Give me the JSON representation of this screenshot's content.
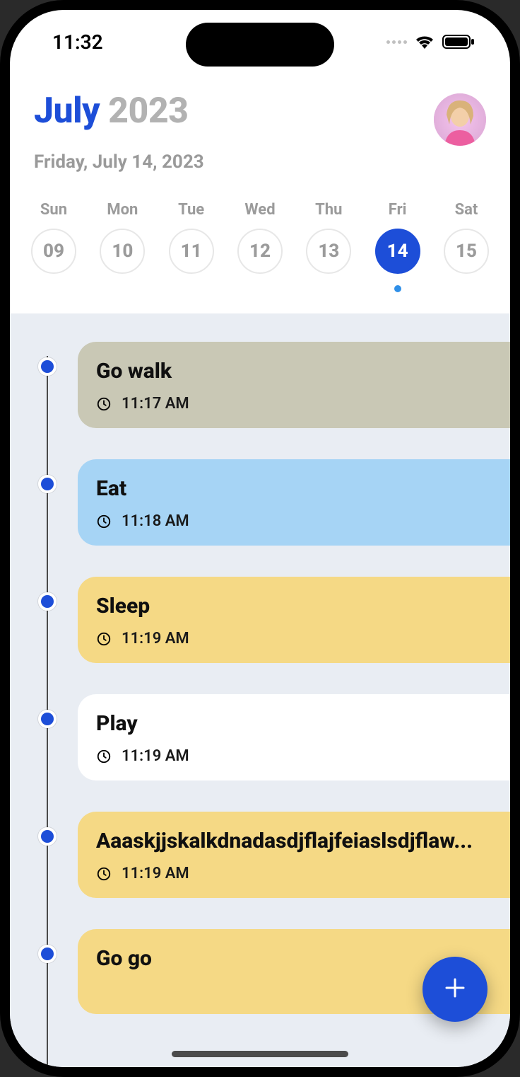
{
  "status": {
    "time": "11:32"
  },
  "header": {
    "month": "July",
    "year": "2023",
    "subtitle": "Friday, July 14, 2023"
  },
  "week": {
    "days": [
      {
        "label": "Sun",
        "num": "09",
        "selected": false,
        "dot": false
      },
      {
        "label": "Mon",
        "num": "10",
        "selected": false,
        "dot": false
      },
      {
        "label": "Tue",
        "num": "11",
        "selected": false,
        "dot": false
      },
      {
        "label": "Wed",
        "num": "12",
        "selected": false,
        "dot": false
      },
      {
        "label": "Thu",
        "num": "13",
        "selected": false,
        "dot": false
      },
      {
        "label": "Fri",
        "num": "14",
        "selected": true,
        "dot": true
      },
      {
        "label": "Sat",
        "num": "15",
        "selected": false,
        "dot": false
      }
    ]
  },
  "timeline": {
    "items": [
      {
        "title": "Go walk",
        "time": "11:17 AM",
        "color": "beige"
      },
      {
        "title": "Eat",
        "time": "11:18 AM",
        "color": "blue"
      },
      {
        "title": "Sleep",
        "time": "11:19 AM",
        "color": "yellow"
      },
      {
        "title": "Play",
        "time": "11:19 AM",
        "color": "white"
      },
      {
        "title": "Aaaskjjskalkdnadasdjflajfeiaslsdjflaw...",
        "time": "11:19 AM",
        "color": "yellow"
      },
      {
        "title": "Go go",
        "time": "",
        "color": "yellow"
      }
    ]
  }
}
